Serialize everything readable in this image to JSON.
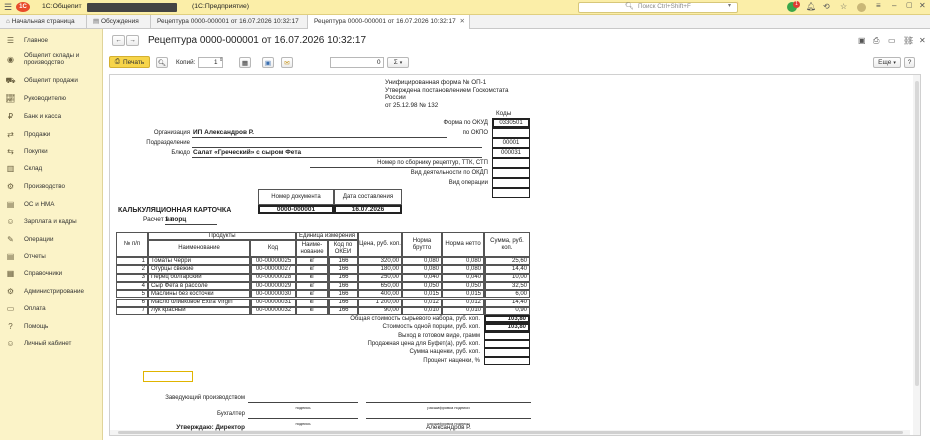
{
  "topbar": {
    "app_name": "1С:Общепит",
    "db_name": "(1С:Предприятие)",
    "search_placeholder": "Поиск Ctrl+Shift+F",
    "notif_count": "1"
  },
  "tabs": [
    {
      "label": "Начальная страница"
    },
    {
      "label": "Обсуждения"
    },
    {
      "label": "Рецептура 0000-000001 от 16.07.2026 10:32:17"
    },
    {
      "label": "Рецептура 0000-000001 от 16.07.2026 10:32:17"
    }
  ],
  "sidebar": {
    "items": [
      {
        "label": "Главное",
        "icon": "menu-icon"
      },
      {
        "label": "Общепит склады и производство",
        "icon": "chef-icon"
      },
      {
        "label": "Общепит продажи",
        "icon": "cart-icon"
      },
      {
        "label": "Руководителю",
        "icon": "chart-icon"
      },
      {
        "label": "Банк и касса",
        "icon": "bank-icon"
      },
      {
        "label": "Продажи",
        "icon": "sales-icon"
      },
      {
        "label": "Покупки",
        "icon": "purchases-icon"
      },
      {
        "label": "Склад",
        "icon": "warehouse-icon"
      },
      {
        "label": "Производство",
        "icon": "factory-icon"
      },
      {
        "label": "ОС и НМА",
        "icon": "assets-icon"
      },
      {
        "label": "Зарплата и кадры",
        "icon": "people-icon"
      },
      {
        "label": "Операции",
        "icon": "operations-icon"
      },
      {
        "label": "Отчеты",
        "icon": "reports-icon"
      },
      {
        "label": "Справочники",
        "icon": "book-icon"
      },
      {
        "label": "Администрирование",
        "icon": "gear-icon"
      },
      {
        "label": "Оплата",
        "icon": "payment-icon"
      },
      {
        "label": "Помощь",
        "icon": "help-icon"
      },
      {
        "label": "Личный кабинет",
        "icon": "user-icon"
      }
    ]
  },
  "doc": {
    "title": "Рецептура 0000-000001 от 16.07.2026 10:32:17",
    "print_label": "Печать",
    "copies_label": "Копий:",
    "copies_value": "1",
    "zero_value": "0",
    "sum_symbol": "Σ",
    "more_label": "Еще"
  },
  "form": {
    "header_lines": [
      "Унифицированная форма № ОП-1",
      "Утверждена постановлением Госкомстата",
      "России",
      "от 25.12.98 № 132"
    ],
    "codes_label": "Коды",
    "okud_label": "Форма по ОКУД",
    "okud_value": "0330501",
    "okpo_label": "по ОКПО",
    "okpo_value": "",
    "org_label": "Организация",
    "org_value": "ИП Александров Р.",
    "dept_label": "Подразделение",
    "dept_value": "00001",
    "dish_label": "Блюдо",
    "dish_value": "Салат «Греческий» с сыром Фета",
    "dish_code": "000031",
    "recipe_no_label": "Номер по сборнику рецептур, ТТК, СТП",
    "okdp_label": "Вид деятельности по ОКДП",
    "op_label": "Вид операции",
    "docnum_header": "Номер документа",
    "docdate_header": "Дата составления",
    "card_title": "КАЛЬКУЛЯЦИОННАЯ КАРТОЧКА",
    "docnum_value": "0000-000001",
    "docdate_value": "16.07.2026",
    "calc_for_label": "Расчет на",
    "calc_for_value": "1 порц"
  },
  "table": {
    "h_num": "№ п/п",
    "h_products": "Продукты",
    "h_name": "Наименование",
    "h_code": "Код",
    "h_unit": "Единица измерения",
    "h_unit_name": "Наиме-нование",
    "h_unit_okei": "Код по ОКЕИ",
    "h_price": "Цена, руб. коп.",
    "h_gross": "Норма брутто",
    "h_net": "Норма нетто",
    "h_sum": "Сумма, руб. коп.",
    "rows": [
      {
        "n": "1",
        "name": "Томаты Черри",
        "code": "00-00000025",
        "unit": "кг",
        "okei": "166",
        "price": "320,00",
        "gross": "0,080",
        "net": "0,080",
        "sum": "25,60"
      },
      {
        "n": "2",
        "name": "Огурцы свежие",
        "code": "00-00000027",
        "unit": "кг",
        "okei": "166",
        "price": "180,00",
        "gross": "0,080",
        "net": "0,080",
        "sum": "14,40"
      },
      {
        "n": "3",
        "name": "Перец болгарский",
        "code": "00-00000028",
        "unit": "кг",
        "okei": "166",
        "price": "250,00",
        "gross": "0,040",
        "net": "0,040",
        "sum": "10,00"
      },
      {
        "n": "4",
        "name": "Сыр Фета в рассоле",
        "code": "00-00000029",
        "unit": "кг",
        "okei": "166",
        "price": "650,00",
        "gross": "0,050",
        "net": "0,050",
        "sum": "32,50"
      },
      {
        "n": "5",
        "name": "Маслины без косточки",
        "code": "00-00000030",
        "unit": "кг",
        "okei": "166",
        "price": "400,00",
        "gross": "0,015",
        "net": "0,015",
        "sum": "6,00"
      },
      {
        "n": "6",
        "name": "Масло оливковое Extra Virgin",
        "code": "00-00000031",
        "unit": "кг",
        "okei": "166",
        "price": "1 200,00",
        "gross": "0,012",
        "net": "0,012",
        "sum": "14,40"
      },
      {
        "n": "7",
        "name": "Лук красный",
        "code": "00-00000032",
        "unit": "кг",
        "okei": "166",
        "price": "90,00",
        "gross": "0,010",
        "net": "0,010",
        "sum": "0,90"
      }
    ],
    "totals": [
      {
        "label": "Общая стоимость сырьевого набора, руб. коп.",
        "value": "103,80"
      },
      {
        "label": "Стоимость одной порции, руб. коп.",
        "value": "103,80"
      },
      {
        "label": "Выход в готовом виде, грамм",
        "value": ""
      },
      {
        "label": "Продажная цена для Буфет(а), руб. коп.",
        "value": ""
      },
      {
        "label": "Сумма наценки, руб. коп.",
        "value": ""
      },
      {
        "label": "Процент наценки, %",
        "value": ""
      }
    ]
  },
  "signatures": {
    "head_label": "Заведующий производством",
    "accountant_label": "Бухгалтер",
    "approve_label": "Утверждаю: Директор",
    "sign_caption": "подпись",
    "decode_caption": "расшифровка подписи",
    "director_name": "Александров Р."
  }
}
